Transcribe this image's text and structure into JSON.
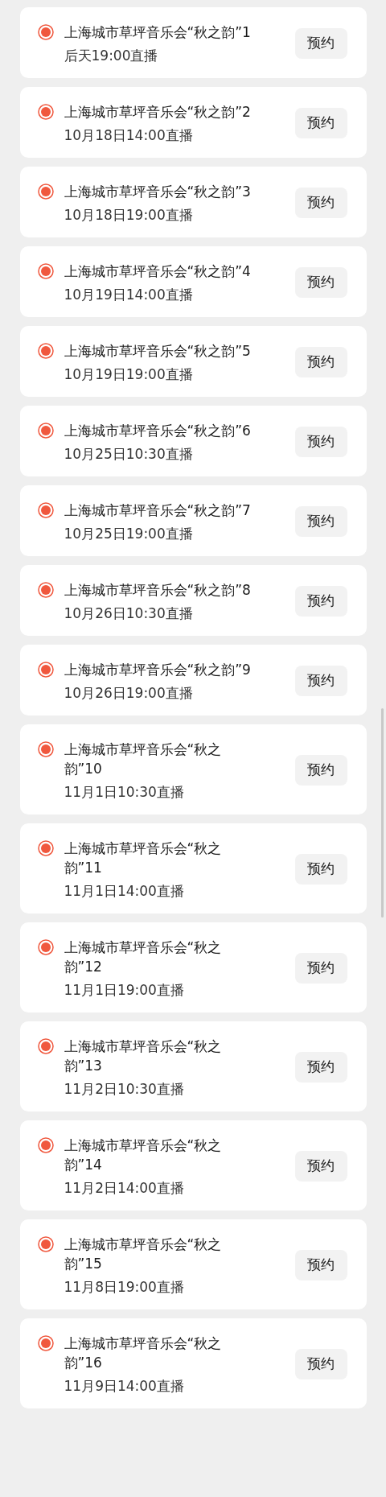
{
  "items": [
    {
      "title": "上海城市草坪音乐会“秋之韵”1",
      "time": "后天19:00直播",
      "button": "预约"
    },
    {
      "title": "上海城市草坪音乐会“秋之韵”2",
      "time": "10月18日14:00直播",
      "button": "预约"
    },
    {
      "title": "上海城市草坪音乐会“秋之韵”3",
      "time": "10月18日19:00直播",
      "button": "预约"
    },
    {
      "title": "上海城市草坪音乐会“秋之韵”4",
      "time": "10月19日14:00直播",
      "button": "预约"
    },
    {
      "title": "上海城市草坪音乐会“秋之韵”5",
      "time": "10月19日19:00直播",
      "button": "预约"
    },
    {
      "title": "上海城市草坪音乐会“秋之韵”6",
      "time": "10月25日10:30直播",
      "button": "预约"
    },
    {
      "title": "上海城市草坪音乐会“秋之韵”7",
      "time": "10月25日19:00直播",
      "button": "预约"
    },
    {
      "title": "上海城市草坪音乐会“秋之韵”8",
      "time": "10月26日10:30直播",
      "button": "预约"
    },
    {
      "title": "上海城市草坪音乐会“秋之韵”9",
      "time": "10月26日19:00直播",
      "button": "预约"
    },
    {
      "title": "上海城市草坪音乐会“秋之韵”10",
      "time": "11月1日10:30直播",
      "button": "预约"
    },
    {
      "title": "上海城市草坪音乐会“秋之韵”11",
      "time": "11月1日14:00直播",
      "button": "预约"
    },
    {
      "title": "上海城市草坪音乐会“秋之韵”12",
      "time": "11月1日19:00直播",
      "button": "预约"
    },
    {
      "title": "上海城市草坪音乐会“秋之韵”13",
      "time": "11月2日10:30直播",
      "button": "预约"
    },
    {
      "title": "上海城市草坪音乐会“秋之韵”14",
      "time": "11月2日14:00直播",
      "button": "预约"
    },
    {
      "title": "上海城市草坪音乐会“秋之韵”15",
      "time": "11月8日19:00直播",
      "button": "预约"
    },
    {
      "title": "上海城市草坪音乐会“秋之韵”16",
      "time": "11月9日14:00直播",
      "button": "预约"
    }
  ]
}
